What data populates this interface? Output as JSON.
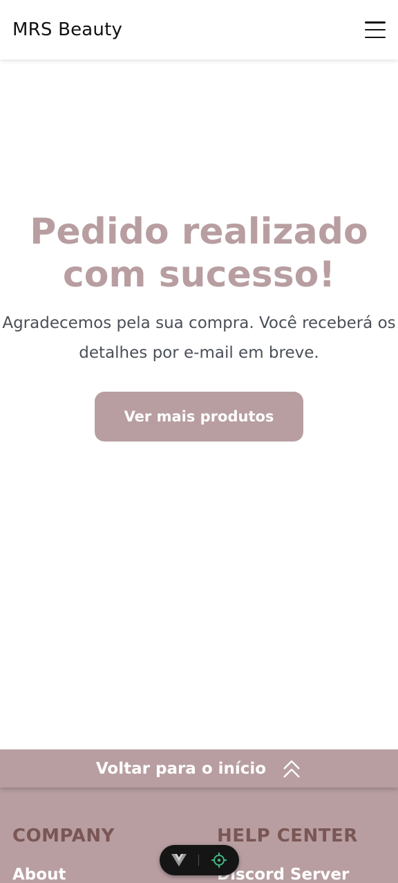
{
  "navbar": {
    "brand": "MRS Beauty",
    "menu_icon": "hamburger-menu-icon"
  },
  "hero": {
    "title": "Pedido realizado com sucesso!",
    "subtitle": "Agradecemos pela sua compra. Você receberá os detalhes por e-mail em breve.",
    "cta_label": "Ver mais produtos"
  },
  "back_to_top": {
    "label": "Voltar para o início",
    "icon": "double-chevron-up-icon"
  },
  "footer": {
    "columns": [
      {
        "heading": "COMPANY",
        "links": [
          "About"
        ]
      },
      {
        "heading": "HELP CENTER",
        "links": [
          "Discord Server"
        ]
      }
    ]
  },
  "devtools": {
    "icons": [
      "vue-logo-icon",
      "crosshair-target-icon"
    ]
  },
  "colors": {
    "accent": "#b89ea1",
    "footer_heading": "#7a5654",
    "text_dark": "#4a4f57",
    "devtools_green": "#42b883"
  }
}
